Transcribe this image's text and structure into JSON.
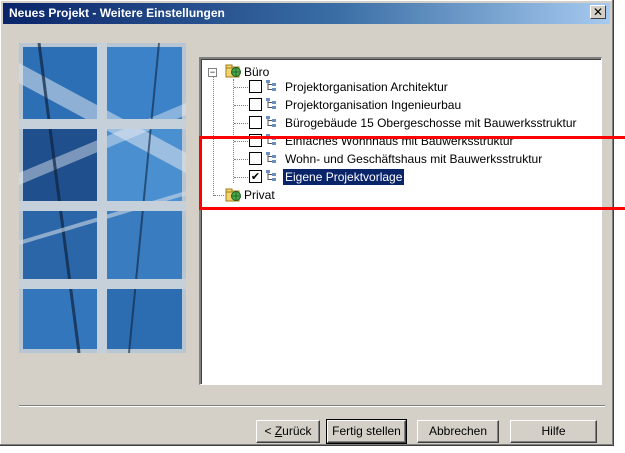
{
  "window": {
    "title": "Neues Projekt - Weitere Einstellungen",
    "close_glyph": "✕"
  },
  "image_panel": {
    "icon": "architecture-photo",
    "tile_colors": [
      "#2c6fb7",
      "#3f86cc",
      "#1e3f6e",
      "#9fb6cc"
    ]
  },
  "tree": {
    "root": {
      "label": "Büro",
      "expander": "−",
      "icon": "folder-globe-icon",
      "children": [
        {
          "label": "Projektorganisation Architektur",
          "checked": false
        },
        {
          "label": "Projektorganisation Ingenieurbau",
          "checked": false
        },
        {
          "label": "Bürogebäude 15 Obergeschosse mit Bauwerksstruktur",
          "checked": false
        },
        {
          "label": "Einfaches Wohnhaus mit Bauwerksstruktur",
          "checked": false
        },
        {
          "label": "Wohn- und Geschäftshaus mit Bauwerksstruktur",
          "checked": false
        },
        {
          "label": "Eigene Projektvorlage",
          "checked": true,
          "selected": true
        }
      ]
    },
    "second_root": {
      "label": "Privat",
      "icon": "folder-globe-icon"
    },
    "check_glyph": "✔"
  },
  "annotation": {
    "color": "#ff0000"
  },
  "buttons": {
    "back_prefix": "< ",
    "back_mnemonic": "Z",
    "back_rest": "urück",
    "finish": "Fertig stellen",
    "cancel": "Abbrechen",
    "help": "Hilfe"
  }
}
